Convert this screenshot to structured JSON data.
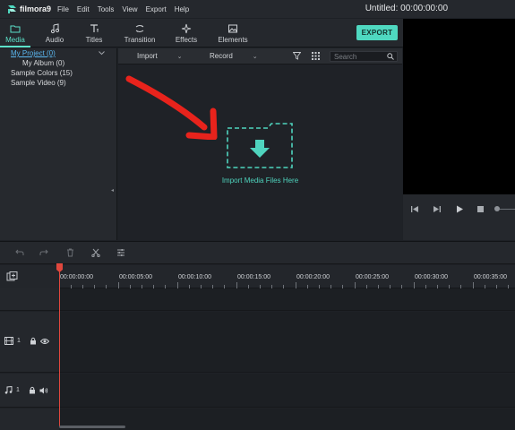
{
  "app": {
    "logo_text": "filmora9",
    "menu": [
      "File",
      "Edit",
      "Tools",
      "View",
      "Export",
      "Help"
    ],
    "title": "Untitled:",
    "timecode": "00:00:00:00"
  },
  "tabs": [
    {
      "label": "Media",
      "icon": "folder-icon",
      "active": true
    },
    {
      "label": "Audio",
      "icon": "music-note-icon",
      "active": false
    },
    {
      "label": "Titles",
      "icon": "text-icon",
      "active": false
    },
    {
      "label": "Transition",
      "icon": "transition-icon",
      "active": false
    },
    {
      "label": "Effects",
      "icon": "sparkle-icon",
      "active": false
    },
    {
      "label": "Elements",
      "icon": "image-icon",
      "active": false
    }
  ],
  "export_label": "EXPORT",
  "library": {
    "items": [
      {
        "label": "My Project (0)",
        "selected": true
      },
      {
        "label": "My Album (0)",
        "selected": false
      },
      {
        "label": "Sample Colors (15)",
        "selected": false
      },
      {
        "label": "Sample Video (9)",
        "selected": false
      }
    ]
  },
  "media_toolbar": {
    "import_label": "Import",
    "record_label": "Record",
    "search_placeholder": "Search"
  },
  "import_zone": {
    "text": "Import Media Files Here"
  },
  "ruler": {
    "labels": [
      "00:00:00:00",
      "00:00:05:00",
      "00:00:10:00",
      "00:00:15:00",
      "00:00:20:00",
      "00:00:25:00",
      "00:00:30:00",
      "00:00:35:00"
    ]
  },
  "tracks": {
    "video_number": "1",
    "audio_number": "1"
  },
  "colors": {
    "accent": "#4fd8c0",
    "playhead": "#e0473d",
    "arrow": "#e8231c",
    "selected_link": "#5bb7f0"
  }
}
